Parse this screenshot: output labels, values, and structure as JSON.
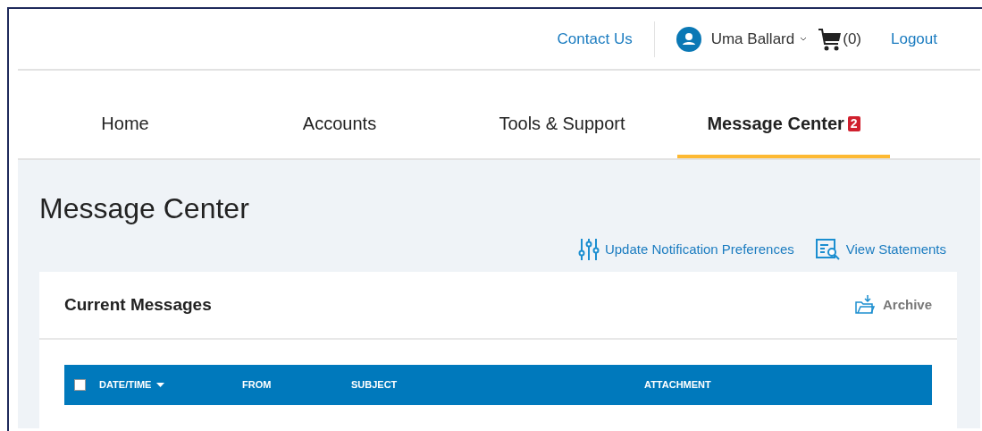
{
  "header": {
    "contact": "Contact Us",
    "user": "Uma Ballard",
    "cart": "(0)",
    "logout": "Logout"
  },
  "tabs": [
    {
      "label": "Home",
      "selected": false
    },
    {
      "label": "Accounts",
      "selected": false
    },
    {
      "label": "Tools & Support",
      "selected": false
    },
    {
      "label": "Message Center",
      "selected": true,
      "badge": "2"
    }
  ],
  "page_title": "Message Center",
  "actions": [
    {
      "kind": "preferences",
      "label": "Update Notification Preferences"
    },
    {
      "kind": "statements",
      "label": "View Statements"
    }
  ],
  "card": {
    "title": "Current Messages",
    "archive": "Archive"
  },
  "table": {
    "select_all": {
      "checked": false
    },
    "columns": [
      {
        "label": "DATE/TIME",
        "sorted": true
      },
      {
        "label": "FROM",
        "sorted": false
      },
      {
        "label": "SUBJECT",
        "sorted": false
      },
      {
        "label": "ATTACHMENT",
        "sorted": false
      }
    ]
  }
}
